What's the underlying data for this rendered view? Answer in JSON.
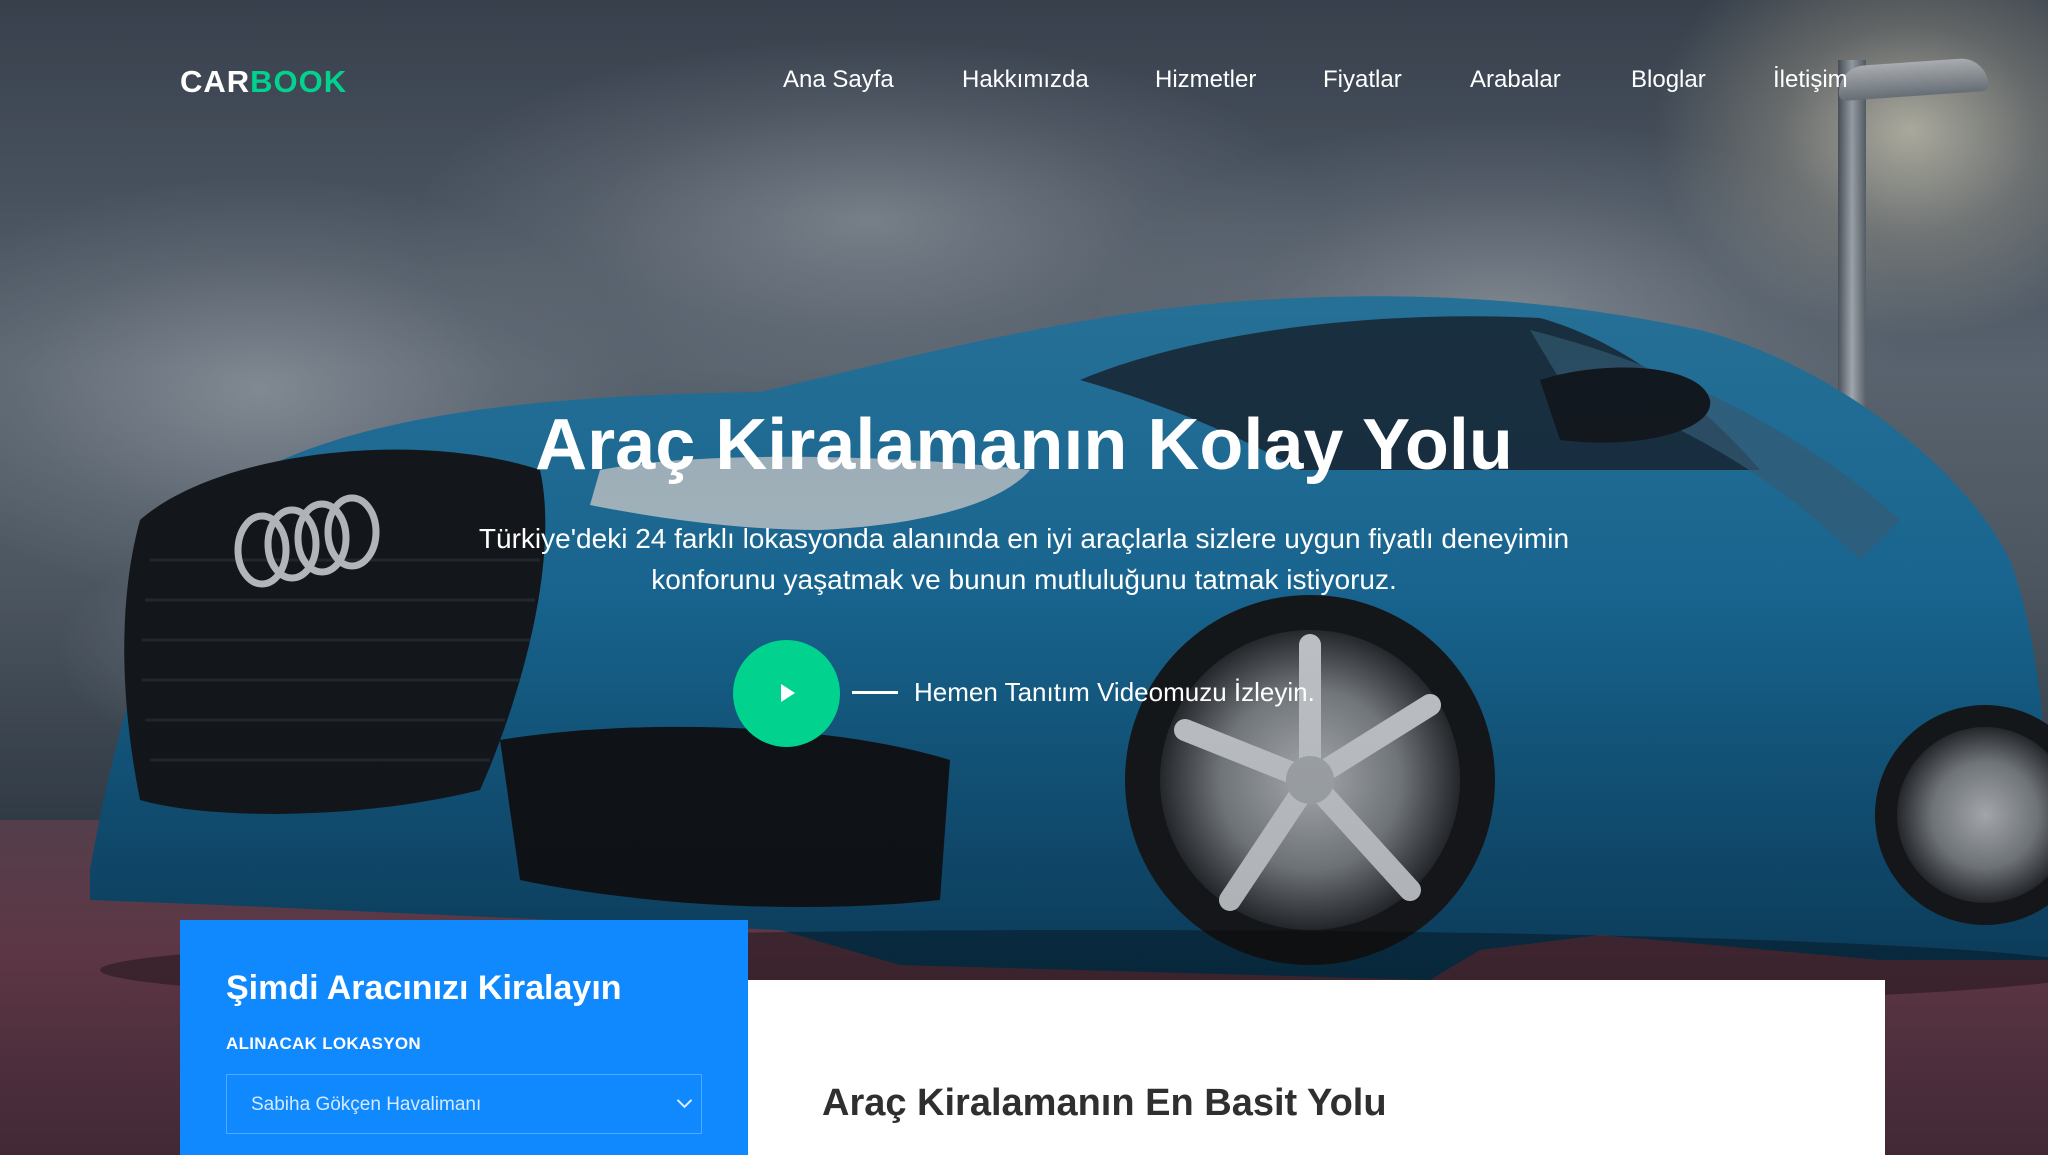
{
  "brand": {
    "logo_part1": "CAR",
    "logo_part2": "BOOK",
    "accent": "#01d28e",
    "primary": "#1089ff"
  },
  "nav": {
    "items": [
      {
        "label": "Ana Sayfa"
      },
      {
        "label": "Hakkımızda"
      },
      {
        "label": "Hizmetler"
      },
      {
        "label": "Fiyatlar"
      },
      {
        "label": "Arabalar"
      },
      {
        "label": "Bloglar"
      },
      {
        "label": "İletişim"
      }
    ]
  },
  "hero": {
    "title": "Araç Kiralamanın Kolay Yolu",
    "description": "Türkiye'deki 24 farklı lokasyonda alanında en iyi araçlarla sizlere uygun fiyatlı deneyimin konforunu yaşatmak ve bunun mutluluğunu tatmak istiyoruz.",
    "video_text": "Hemen Tanıtım Videomuzu İzleyin.",
    "play_icon": "play-icon"
  },
  "booking": {
    "title": "Şimdi Aracınızı Kiralayın",
    "pickup_label": "ALINACAK LOKASYON",
    "pickup_value": "Sabiha Gökçen Havalimanı"
  },
  "steps": {
    "title": "Araç Kiralamanın En Basit Yolu"
  }
}
